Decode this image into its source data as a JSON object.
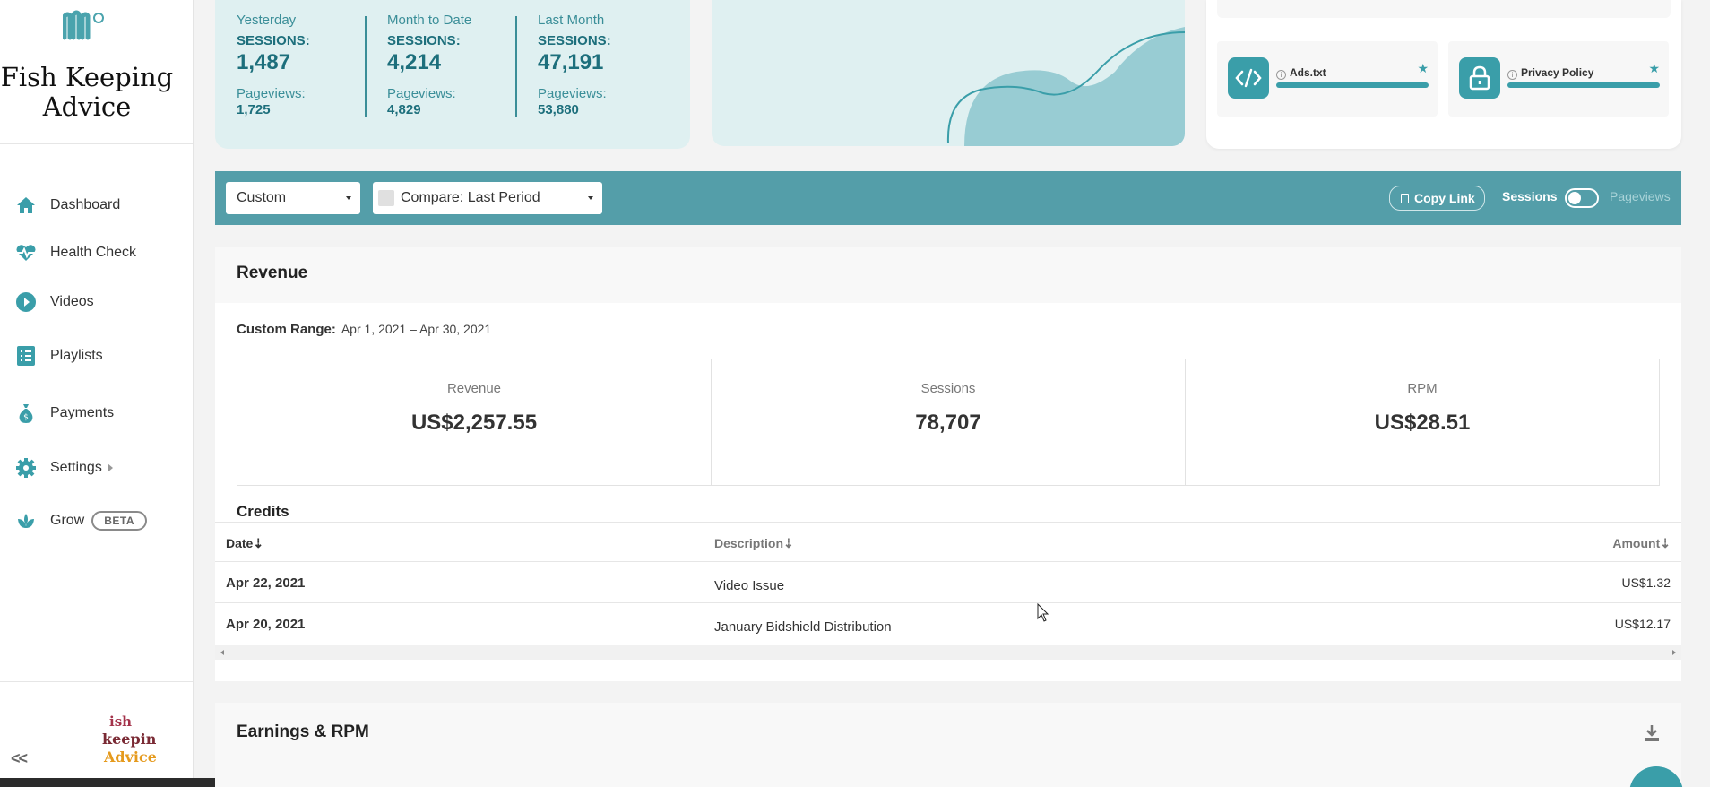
{
  "sidebar": {
    "site_title": "Fish Keeping Advice",
    "items": [
      {
        "label": "Dashboard",
        "icon": "home-icon"
      },
      {
        "label": "Health Check",
        "icon": "heartbeat-icon"
      },
      {
        "label": "Videos",
        "icon": "play-icon"
      },
      {
        "label": "Playlists",
        "icon": "list-icon"
      },
      {
        "label": "Payments",
        "icon": "money-bag-icon"
      },
      {
        "label": "Settings",
        "icon": "gear-icon"
      },
      {
        "label": "Grow",
        "icon": "grow-icon",
        "badge": "BETA"
      }
    ],
    "collapse_label": "<<",
    "logo_text": "Fish Keeping Advice"
  },
  "stats": [
    {
      "period": "Yesterday",
      "sessions_label": "SESSIONS:",
      "sessions": "1,487",
      "pageviews_label": "Pageviews:",
      "pageviews": "1,725"
    },
    {
      "period": "Month to Date",
      "sessions_label": "SESSIONS:",
      "sessions": "4,214",
      "pageviews_label": "Pageviews:",
      "pageviews": "4,829"
    },
    {
      "period": "Last Month",
      "sessions_label": "SESSIONS:",
      "sessions": "47,191",
      "pageviews_label": "Pageviews:",
      "pageviews": "53,880"
    }
  ],
  "tools": [
    {
      "name": "Ads.txt",
      "icon": "code-icon"
    },
    {
      "name": "Privacy Policy",
      "icon": "lock-icon"
    }
  ],
  "filter": {
    "range_select": "Custom",
    "compare_select": "Compare: Last Period",
    "copy_link": "Copy Link",
    "toggle_left": "Sessions",
    "toggle_right": "Pageviews"
  },
  "revenue": {
    "title": "Revenue",
    "range_label": "Custom Range:",
    "range_value": "Apr 1, 2021 – Apr 30, 2021",
    "metrics": [
      {
        "label": "Revenue",
        "value": "US$2,257.55"
      },
      {
        "label": "Sessions",
        "value": "78,707"
      },
      {
        "label": "RPM",
        "value": "US$28.51"
      }
    ],
    "credits_title": "Credits",
    "columns": [
      "Date",
      "Description",
      "Amount"
    ],
    "rows": [
      {
        "date": "Apr 22, 2021",
        "description": "Video Issue",
        "amount": "US$1.32"
      },
      {
        "date": "Apr 20, 2021",
        "description": "January Bidshield Distribution",
        "amount": "US$12.17"
      }
    ]
  },
  "earnings": {
    "title": "Earnings & RPM"
  },
  "colors": {
    "accent": "#549ea9",
    "accent_dark": "#1d6f7c",
    "card_bg": "#dff0f1"
  }
}
